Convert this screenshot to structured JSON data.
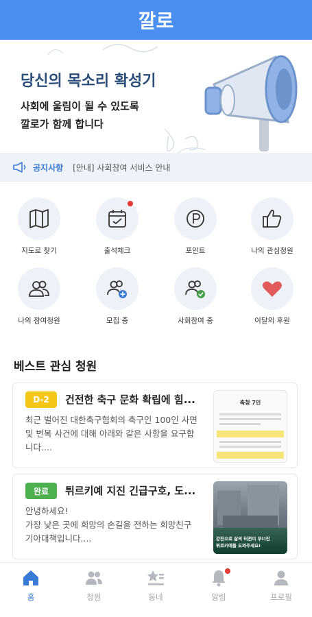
{
  "header": {
    "title": "깔로"
  },
  "banner": {
    "title": "당신의 목소리 확성기",
    "subtitle_line1": "사회에 울림이 될 수 있도록",
    "subtitle_line2": "깔로가 함께 합니다"
  },
  "notice": {
    "label": "공지사항",
    "text": "[안내] 사회참여 서비스 안내"
  },
  "grid": [
    {
      "label": "지도로 찾기",
      "icon": "map-icon"
    },
    {
      "label": "출석체크",
      "icon": "calendar-check-icon",
      "dot": true
    },
    {
      "label": "포인트",
      "icon": "point-icon"
    },
    {
      "label": "나의 관심청원",
      "icon": "thumbs-up-icon"
    },
    {
      "label": "나의 참여청원",
      "icon": "people-icon"
    },
    {
      "label": "모집 중",
      "icon": "people-plus-icon"
    },
    {
      "label": "사회참여 중",
      "icon": "people-check-icon"
    },
    {
      "label": "이달의 후원",
      "icon": "heart-icon"
    }
  ],
  "section": {
    "title": "베스트 관심 청원"
  },
  "cards": [
    {
      "badge": "D-2",
      "badge_color": "#f5c518",
      "title": "건전한 축구 문화 확립에 힘...",
      "body_lines": [
        "최근 벌어진 대한축구협회의 축구인 100인 사면",
        "및 번복 사건에 대해 아래와 같은 사항을 요구합",
        "니다...."
      ],
      "thumb_title": "촉청 7인"
    },
    {
      "badge": "완료",
      "badge_color": "#4caf50",
      "title": "튀르키예 지진 긴급구호, 도...",
      "body_lines": [
        "안녕하세요!",
        "가장 낮은 곳에 희망의 손길을 전하는 희망친구",
        "기아대책입니다...."
      ],
      "thumb_caption_line1": "강진으로 삶의 터전이 무너진",
      "thumb_caption_line2": "튀르키예를 도와주세요!"
    }
  ],
  "tabs": [
    {
      "label": "홈",
      "icon": "home-icon",
      "active": true
    },
    {
      "label": "청원",
      "icon": "people-icon"
    },
    {
      "label": "동네",
      "icon": "star-list-icon"
    },
    {
      "label": "알림",
      "icon": "bell-icon",
      "dot": true
    },
    {
      "label": "프로필",
      "icon": "person-icon"
    }
  ],
  "colors": {
    "primary": "#4a8ff0",
    "accent": "#3a7bd5",
    "alert": "#e53935"
  }
}
